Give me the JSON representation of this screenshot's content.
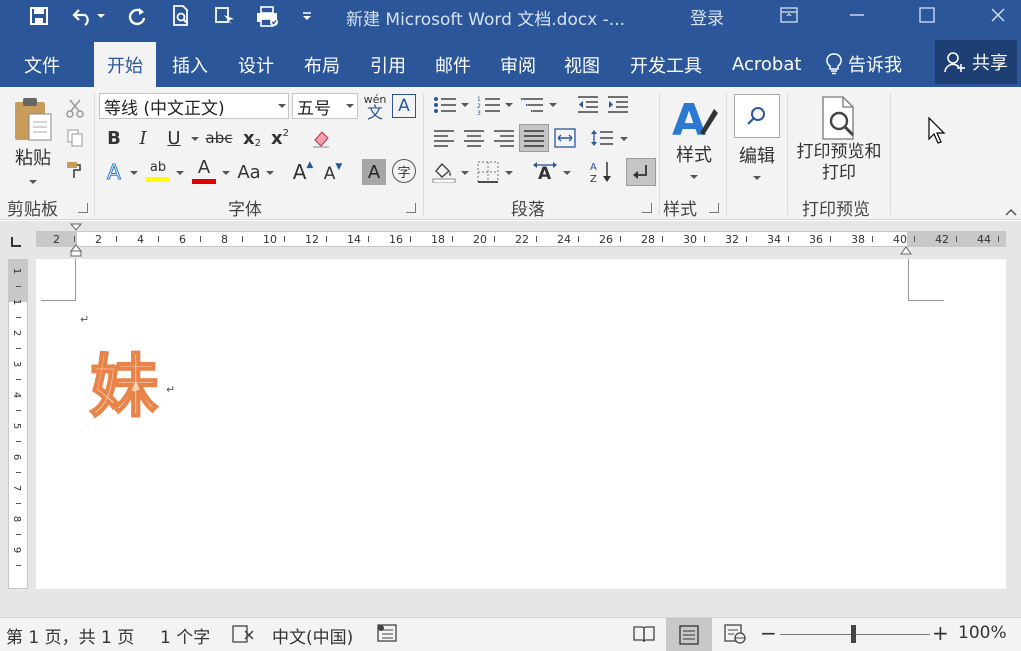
{
  "window": {
    "title": "新建 Microsoft Word 文档.docx  -...",
    "login": "登录"
  },
  "tabs": [
    "文件",
    "开始",
    "插入",
    "设计",
    "布局",
    "引用",
    "邮件",
    "审阅",
    "视图",
    "开发工具",
    "Acrobat"
  ],
  "active_tab": "开始",
  "tell_me": "告诉我",
  "share": "共享",
  "ribbon": {
    "clipboard": {
      "paste": "粘贴",
      "label": "剪贴板"
    },
    "font": {
      "font_name": "等线 (中文正文)",
      "font_size": "五号",
      "phonetic_top": "wén",
      "phonetic_bottom": "文",
      "char_border": "A",
      "bold": "B",
      "italic": "I",
      "underline": "U",
      "strike": "abc",
      "subscript": "x",
      "subscript_digit": "2",
      "superscript": "x",
      "superscript_digit": "2",
      "text_effect": "A",
      "highlight": "ab",
      "font_color": "A",
      "change_case": "Aa",
      "grow": "A",
      "shrink": "A",
      "char_shading": "A",
      "enclose": "字",
      "label": "字体",
      "colors": {
        "highlight": "#ffff00",
        "font_color": "#e00000"
      }
    },
    "paragraph": {
      "label": "段落"
    },
    "styles": {
      "button": "样式",
      "label": "样式"
    },
    "editing": {
      "button": "编辑"
    },
    "print_preview": {
      "button_line1": "打印预览和",
      "button_line2": "打印",
      "label": "打印预览"
    }
  },
  "ruler": {
    "h_numbers": [
      "2",
      "2",
      "4",
      "6",
      "8",
      "10",
      "12",
      "14",
      "16",
      "18",
      "20",
      "22",
      "24",
      "26",
      "28",
      "30",
      "32",
      "34",
      "36",
      "38",
      "40",
      "42",
      "44"
    ],
    "v_numbers": [
      "1",
      "1",
      "2",
      "3",
      "4",
      "5",
      "6",
      "7",
      "8",
      "9"
    ]
  },
  "document": {
    "content": "妹",
    "paragraph_mark": "↵"
  },
  "statusbar": {
    "page": "第 1 页，共 1 页",
    "words": "1 个字",
    "language": "中文(中国)",
    "zoom": "100%",
    "zoom_minus": "−",
    "zoom_plus": "+"
  }
}
